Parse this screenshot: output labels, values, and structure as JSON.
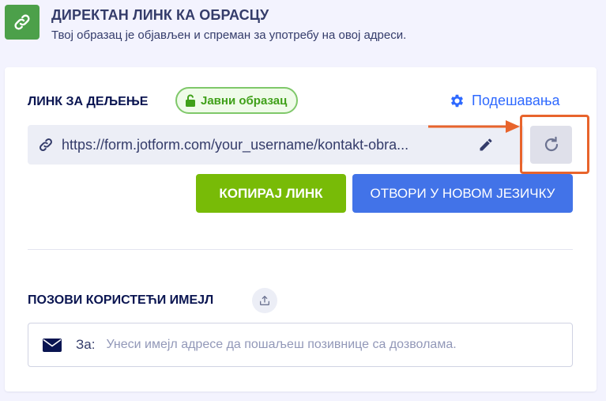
{
  "header": {
    "title": "ДИРЕКТАН ЛИНК КА ОБРАСЦУ",
    "subtitle": "Твој образац је објављен и спреман за употребу на овој адреси.",
    "icon": "link-icon"
  },
  "share": {
    "label": "ЛИНК ЗА ДЕЉЕЊЕ",
    "badge": "Јавни образац",
    "badge_icon": "unlock-icon",
    "settings_label": "Подешавања",
    "settings_icon": "gear-icon",
    "url": "https://form.jotform.com/your_username/kontakt-obra...",
    "copy_label": "КОПИРАЈ ЛИНК",
    "open_label": "ОТВОРИ У НОВОМ ЈЕЗИЧКУ",
    "refresh_icon": "refresh-icon",
    "edit_icon": "pencil-icon"
  },
  "invite": {
    "label": "ПОЗОВИ КОРИСТЕЋИ ИМЕЈЛ",
    "to_label": "За:",
    "placeholder": "Унеси имејл адресе да пошаљеш позивнице са дозволама.",
    "value": ""
  },
  "colors": {
    "primary_blue": "#4273e8",
    "copy_green": "#78bb07",
    "badge_green": "#3fa019",
    "highlight_orange": "#e8642c",
    "header_icon_bg": "#4ca04a"
  }
}
